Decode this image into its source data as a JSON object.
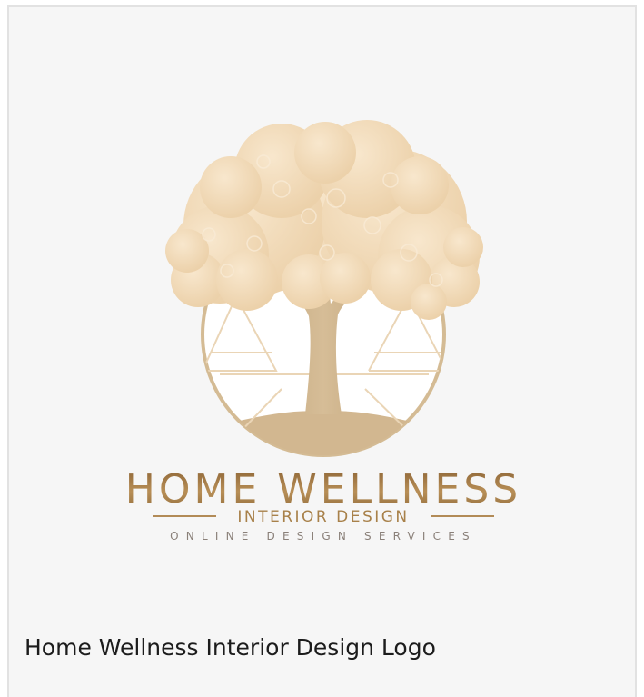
{
  "product": {
    "caption": "Home Wellness Interior Design Logo"
  },
  "logo": {
    "brand_name": "HOME WELLNESS",
    "line_left": "——",
    "subtitle": "INTERIOR DESIGN",
    "line_right": "——",
    "tagline": "ONLINE DESIGN SERVICES",
    "icon": "tree-in-circle-icon"
  },
  "colors": {
    "card_background": "#f6f6f6",
    "card_border": "#e2e2e2",
    "canopy": "#f1d8b4",
    "trunk": "#cfb48c",
    "gold_text": "#a8814a",
    "caption_text": "#1c1c1c"
  }
}
